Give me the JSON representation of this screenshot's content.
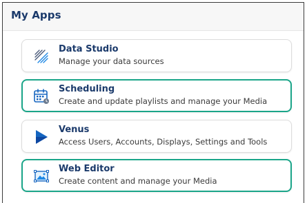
{
  "panel": {
    "title": "My Apps"
  },
  "apps": [
    {
      "title": "Data Studio",
      "description": "Manage your data sources",
      "icon": "data-studio-icon",
      "highlighted": false
    },
    {
      "title": "Scheduling",
      "description": "Create and update playlists and manage your Media",
      "icon": "calendar-icon",
      "highlighted": true
    },
    {
      "title": "Venus",
      "description": "Access Users, Accounts, Displays, Settings and Tools",
      "icon": "play-triangle-icon",
      "highlighted": false
    },
    {
      "title": "Web Editor",
      "description": "Create content and manage your Media",
      "icon": "image-editor-icon",
      "highlighted": true
    }
  ],
  "colors": {
    "title": "#1b3a6b",
    "highlight_border": "#1aa589",
    "accent_blue": "#1565c0"
  }
}
